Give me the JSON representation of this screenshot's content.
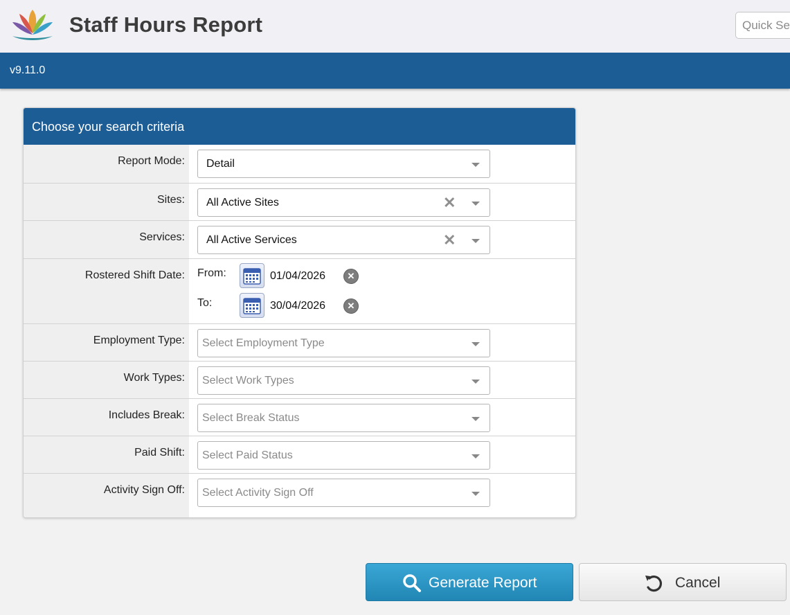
{
  "app": {
    "title": "Staff Hours Report",
    "version": "v9.11.0",
    "quick_search_placeholder": "Quick Search"
  },
  "panel": {
    "title": "Choose your search criteria"
  },
  "fields": {
    "report_mode": {
      "label": "Report Mode:",
      "value": "Detail"
    },
    "sites": {
      "label": "Sites:",
      "value": "All Active Sites"
    },
    "services": {
      "label": "Services:",
      "value": "All Active Services"
    },
    "shift_date": {
      "label": "Rostered Shift Date:",
      "from_label": "From:",
      "from_value": "01/04/2026",
      "to_label": "To:",
      "to_value": "30/04/2026"
    },
    "employment_type": {
      "label": "Employment Type:",
      "placeholder": "Select Employment Type"
    },
    "work_types": {
      "label": "Work Types:",
      "placeholder": "Select Work Types"
    },
    "includes_break": {
      "label": "Includes Break:",
      "placeholder": "Select Break Status"
    },
    "paid_shift": {
      "label": "Paid Shift:",
      "placeholder": "Select Paid Status"
    },
    "activity_sign_off": {
      "label": "Activity Sign Off:",
      "placeholder": "Select Activity Sign Off"
    }
  },
  "buttons": {
    "generate": "Generate Report",
    "cancel": "Cancel"
  },
  "icons": {
    "logo": "lotus-logo-icon",
    "search": "search-icon",
    "undo": "undo-icon",
    "calendar": "calendar-icon",
    "clear": "clear-icon",
    "caret": "caret-down-icon"
  },
  "colors": {
    "primary": "#1c5d96",
    "button_primary": "#2186b4",
    "label_bg": "#efefef"
  }
}
